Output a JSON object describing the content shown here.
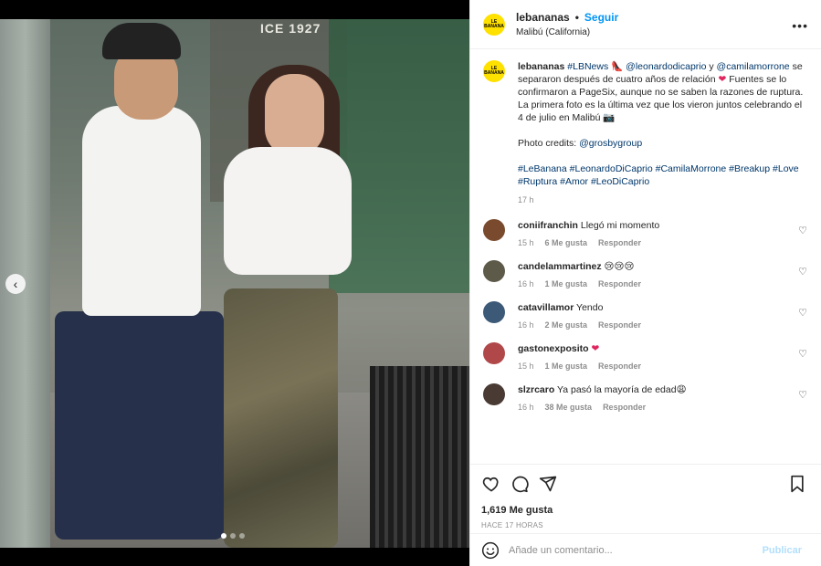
{
  "media": {
    "store_sign": "ICE 1927",
    "carousel_dots": 3,
    "active_dot": 1
  },
  "header": {
    "username": "lebananas",
    "follow_label": "Seguir",
    "location": "Malibú (California)",
    "avatar_text": "LE BANANA"
  },
  "caption": {
    "username": "lebananas",
    "tag_lbnews": "#LBNews",
    "emoji1": "👠",
    "mention1": "@leonardodicaprio",
    "conj": " y ",
    "mention2": "@camilamorrone",
    "text1": " se separaron después de cuatro años de relación ",
    "heart": "❤",
    "text2": " Fuentes se lo confirmaron a PageSix, aunque no se saben la razones de ruptura. La primera foto es la última vez que los vieron juntos celebrando el 4 de julio en Malibú ",
    "camera": "📷",
    "credits_label": "Photo credits: ",
    "credits_mention": "@grosbygroup",
    "hashtags": "#LeBanana #LeonardoDiCaprio #CamilaMorrone #Breakup #Love #Ruptura #Amor #LeoDiCaprio",
    "time": "17 h"
  },
  "comments": [
    {
      "user": "coniifranchin",
      "text": "Llegó mi momento",
      "time": "15 h",
      "likes": "6 Me gusta",
      "reply": "Responder",
      "avatar_color": "#7a4a2e"
    },
    {
      "user": "candelammartinez",
      "text": "😢😢😢",
      "time": "16 h",
      "likes": "1 Me gusta",
      "reply": "Responder",
      "avatar_color": "#5e5a4a"
    },
    {
      "user": "catavillamor",
      "text": "Yendo",
      "time": "16 h",
      "likes": "2 Me gusta",
      "reply": "Responder",
      "avatar_color": "#3c5a78"
    },
    {
      "user": "gastonexposito",
      "text": "❤",
      "time": "15 h",
      "likes": "1 Me gusta",
      "reply": "Responder",
      "avatar_color": "#b0484a"
    },
    {
      "user": "slzrcaro",
      "text": "Ya pasó la mayoría de edad😩",
      "time": "16 h",
      "likes": "38 Me gusta",
      "reply": "Responder",
      "avatar_color": "#4a3a34"
    }
  ],
  "actions": {
    "likes": "1,619 Me gusta",
    "ago": "HACE 17 HORAS"
  },
  "add_comment": {
    "placeholder": "Añade un comentario...",
    "post_label": "Publicar"
  },
  "colors": {
    "follow": "#0095f6",
    "brand_yellow": "#ffe100",
    "link": "#00376b",
    "post_disabled": "#b2dffc"
  }
}
